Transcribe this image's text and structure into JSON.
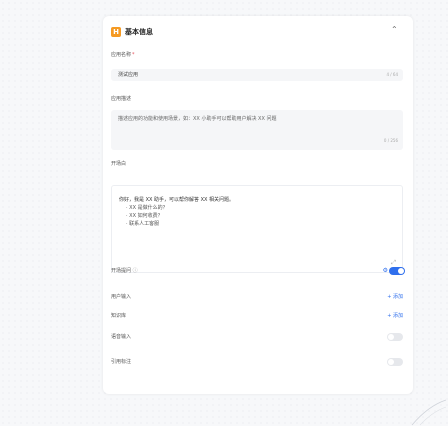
{
  "section": {
    "title": "基本信息",
    "logo_glyph": "H"
  },
  "name_field": {
    "label": "应用名称",
    "required_mark": "*",
    "value": "测试应用",
    "counter": "4 / 64"
  },
  "description": {
    "label": "应用描述",
    "text": "描述应用的功能和使用场景，如：XX 小助手可以帮助用户解决 XX 问题",
    "counter": "0 / 256"
  },
  "opening": {
    "label": "开场白",
    "lines": [
      "你好，我是 XX 助手，可以帮你解答 XX 相关问题。",
      "· XX 是做什么的？",
      "· XX 如何收费？",
      "· 联系人工客服"
    ]
  },
  "suggestions": {
    "label": "开场提问",
    "info_icon": "ⓘ",
    "enabled": true
  },
  "variables": {
    "label": "用户输入",
    "add_label": "+ 添加"
  },
  "tags": {
    "label": "知识库",
    "add_label": "+ 添加"
  },
  "voice_input": {
    "label": "语音输入",
    "enabled": false
  },
  "citation": {
    "label": "引用标注",
    "enabled": false
  },
  "colors": {
    "accent": "#2f6fed",
    "logo": "#f59a23"
  }
}
